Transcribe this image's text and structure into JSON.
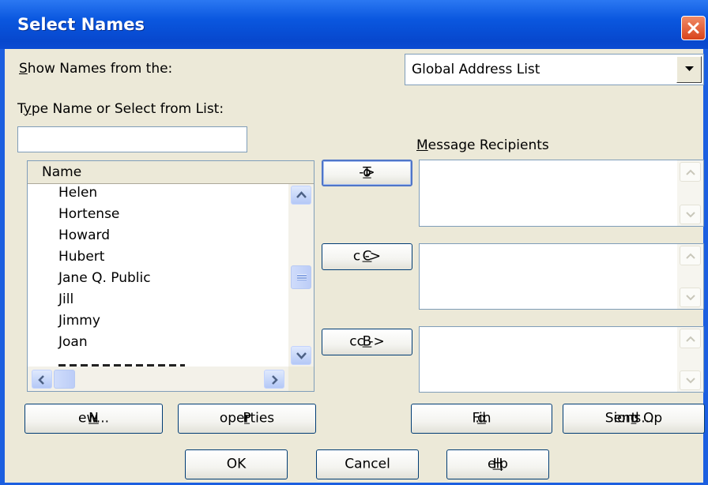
{
  "window": {
    "title": "Select Names"
  },
  "source": {
    "label_accel": "S",
    "label_rest": "how Names from the:",
    "selected": "Global Address List"
  },
  "search": {
    "label_pre": "T",
    "label_accel": "y",
    "label_rest": "pe Name or Select from List:",
    "value": ""
  },
  "list": {
    "column_header": "Name",
    "items": [
      "Helen",
      "Hortense",
      "Howard",
      "Hubert",
      "Jane Q. Public",
      "Jill",
      "Jimmy",
      "Joan"
    ]
  },
  "recipients": {
    "label_accel": "M",
    "label_rest": "essage Recipients",
    "to_button": {
      "pre": "T",
      "accel": "o",
      "post": " ->"
    },
    "cc_button": {
      "pre": "",
      "accel": "C",
      "post": "c ->"
    },
    "bcc_button": {
      "pre": "",
      "accel": "B",
      "post": "cc ->"
    }
  },
  "actions": {
    "new": {
      "pre": "",
      "accel": "N",
      "post": "ew..."
    },
    "properties": {
      "pre": "P",
      "accel": "r",
      "post": "operties"
    },
    "find": {
      "pre": "Fin",
      "accel": "d",
      "post": "..."
    },
    "send_options": {
      "pre": "Send Op",
      "accel": "t",
      "post": "ions..."
    }
  },
  "footer": {
    "ok": "OK",
    "cancel": "Cancel",
    "help": {
      "accel": "H",
      "rest": "elp"
    }
  },
  "colors": {
    "titlebar": "#0a57df",
    "dialog_background": "#ece9d8",
    "close_button": "#e0532a"
  },
  "icons": [
    "close-icon",
    "dropdown-arrow-icon",
    "scroll-up-icon",
    "scroll-down-icon",
    "scroll-left-icon",
    "scroll-right-icon"
  ]
}
